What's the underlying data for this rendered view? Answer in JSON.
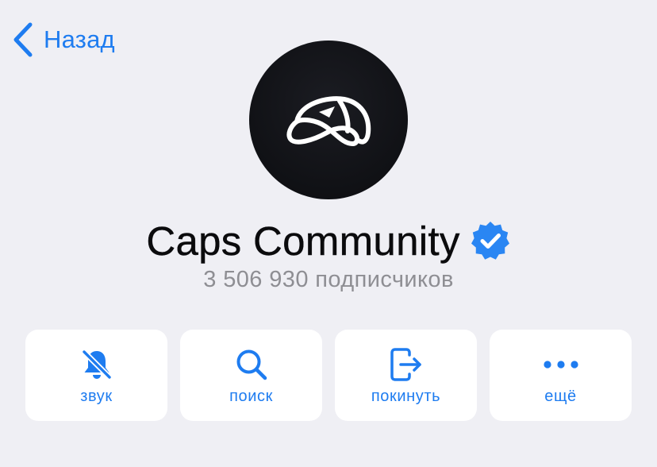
{
  "nav": {
    "back_label": "Назад",
    "back_icon": "chevron-left-icon"
  },
  "channel": {
    "name": "Caps Community",
    "verified": true,
    "subscribers": "3 506 930 подписчиков",
    "avatar_icon": "cap-logo-icon"
  },
  "actions": [
    {
      "label": "звук",
      "icon": "bell-muted-icon"
    },
    {
      "label": "поиск",
      "icon": "search-icon"
    },
    {
      "label": "покинуть",
      "icon": "leave-icon"
    },
    {
      "label": "ещё",
      "icon": "more-icon"
    }
  ],
  "colors": {
    "background": "#efeff4",
    "accent": "#1e7cf0",
    "card": "#ffffff",
    "title_text": "#0b0b0d",
    "secondary_text": "#8e8e93",
    "avatar_bg": "#121317"
  }
}
